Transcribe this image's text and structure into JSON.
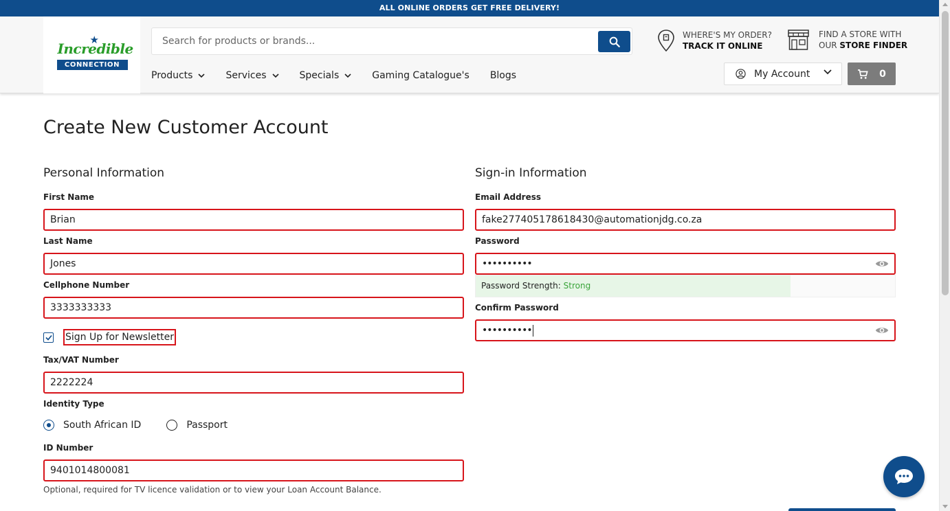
{
  "promo_banner": "ALL ONLINE ORDERS GET FREE DELIVERY!",
  "logo": {
    "word": "Incredible",
    "band": "CONNECTION"
  },
  "search": {
    "placeholder": "Search for products or brands...",
    "value": ""
  },
  "nav": {
    "items": [
      {
        "label": "Products",
        "has_dropdown": true
      },
      {
        "label": "Services",
        "has_dropdown": true
      },
      {
        "label": "Specials",
        "has_dropdown": true
      },
      {
        "label": "Gaming Catalogue's",
        "has_dropdown": false
      },
      {
        "label": "Blogs",
        "has_dropdown": false
      }
    ]
  },
  "utilities": {
    "order": {
      "line1": "WHERE'S MY ORDER?",
      "line2": "TRACK IT ONLINE"
    },
    "store": {
      "line1_prefix": "FIND A STORE WITH",
      "line2_prefix": "OUR ",
      "line2_bold": "STORE FINDER"
    }
  },
  "account": {
    "label": "My Account"
  },
  "cart": {
    "count": "0"
  },
  "page_title": "Create New Customer Account",
  "personal": {
    "title": "Personal Information",
    "first_name": {
      "label": "First Name",
      "value": "Brian"
    },
    "last_name": {
      "label": "Last Name",
      "value": "Jones"
    },
    "cellphone": {
      "label": "Cellphone Number",
      "value": "3333333333"
    },
    "newsletter": {
      "label": "Sign Up for Newsletter",
      "checked": true
    },
    "tax_vat": {
      "label": "Tax/VAT Number",
      "value": "2222224"
    },
    "identity_type": {
      "label": "Identity Type",
      "options": [
        "South African ID",
        "Passport"
      ],
      "selected": "South African ID"
    },
    "id_number": {
      "label": "ID Number",
      "value": "9401014800081"
    },
    "id_hint": "Optional, required for TV licence validation or to view your Loan Account Balance."
  },
  "signin": {
    "title": "Sign-in Information",
    "email": {
      "label": "Email Address",
      "value": "fake277405178618430@automationjdg.co.za"
    },
    "password": {
      "label": "Password",
      "masked": "••••••••••"
    },
    "strength": {
      "label": "Password Strength: ",
      "value": "Strong",
      "fill": 0.75
    },
    "confirm_password": {
      "label": "Confirm Password",
      "masked": "••••••••••"
    }
  },
  "colors": {
    "brand_blue": "#0f4d8c",
    "error_red": "#d7141a",
    "strength_green": "#3aa43a",
    "logo_green": "#2a9d2a"
  },
  "icons": [
    "search-icon",
    "chevron-down-icon",
    "location-pin-icon",
    "storefront-icon",
    "user-circle-icon",
    "cart-icon",
    "eye-icon",
    "checkbox-checked-icon",
    "chat-bubble-icon"
  ]
}
